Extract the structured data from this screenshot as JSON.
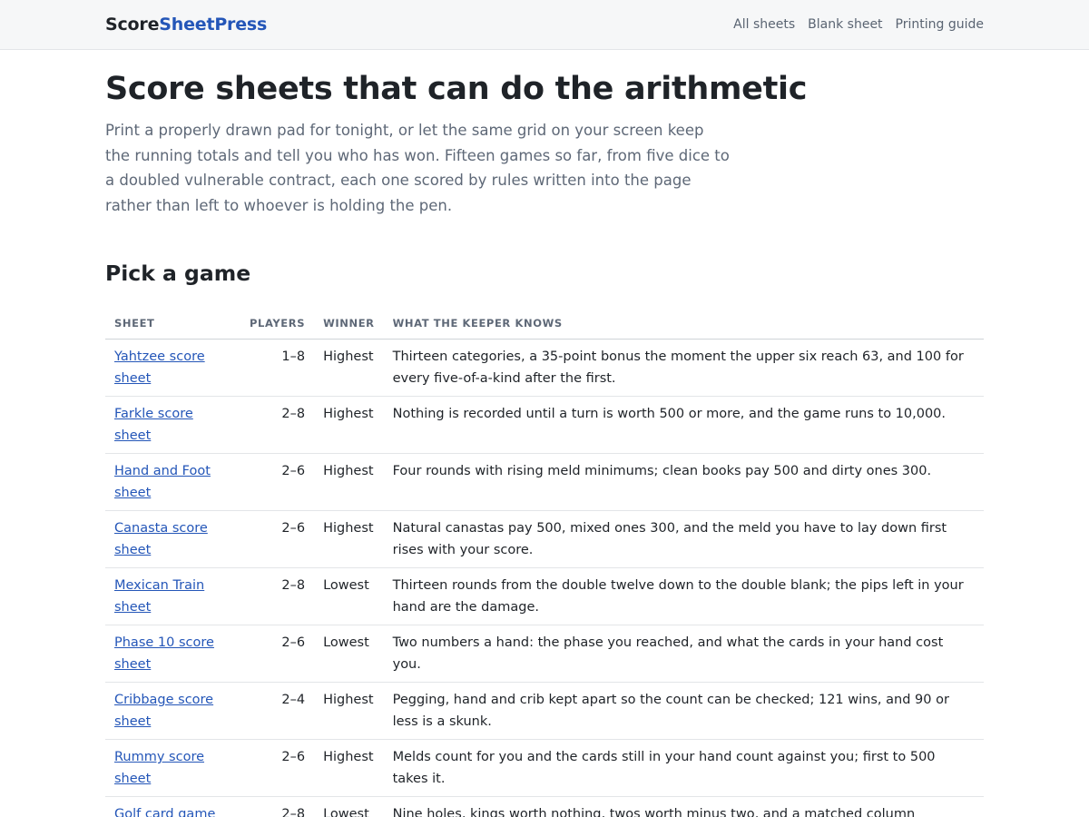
{
  "brand": {
    "part1": "Score",
    "part2": "SheetPress"
  },
  "nav": [
    "All sheets",
    "Blank sheet",
    "Printing guide"
  ],
  "hero": {
    "title": "Score sheets that can do the arithmetic",
    "intro": "Print a properly drawn pad for tonight, or let the same grid on your screen keep the running totals and tell you who has won. Fifteen games so far, from five dice to a doubled vulnerable contract, each one scored by rules written into the page rather than left to whoever is holding the pen."
  },
  "section_title": "Pick a game",
  "table": {
    "headers": [
      "Sheet",
      "Players",
      "Winner",
      "What the keeper knows"
    ],
    "rows": [
      {
        "sheet": "Yahtzee score sheet",
        "players": "1–8",
        "winner": "Highest",
        "notes": "Thirteen categories, a 35-point bonus the moment the upper six reach 63, and 100 for every five-of-a-kind after the first."
      },
      {
        "sheet": "Farkle score sheet",
        "players": "2–8",
        "winner": "Highest",
        "notes": "Nothing is recorded until a turn is worth 500 or more, and the game runs to 10,000."
      },
      {
        "sheet": "Hand and Foot sheet",
        "players": "2–6",
        "winner": "Highest",
        "notes": "Four rounds with rising meld minimums; clean books pay 500 and dirty ones 300."
      },
      {
        "sheet": "Canasta score sheet",
        "players": "2–6",
        "winner": "Highest",
        "notes": "Natural canastas pay 500, mixed ones 300, and the meld you have to lay down first rises with your score."
      },
      {
        "sheet": "Mexican Train sheet",
        "players": "2–8",
        "winner": "Lowest",
        "notes": "Thirteen rounds from the double twelve down to the double blank; the pips left in your hand are the damage."
      },
      {
        "sheet": "Phase 10 score sheet",
        "players": "2–6",
        "winner": "Lowest",
        "notes": "Two numbers a hand: the phase you reached, and what the cards in your hand cost you."
      },
      {
        "sheet": "Cribbage score sheet",
        "players": "2–4",
        "winner": "Highest",
        "notes": "Pegging, hand and crib kept apart so the count can be checked; 121 wins, and 90 or less is a skunk."
      },
      {
        "sheet": "Rummy score sheet",
        "players": "2–6",
        "winner": "Highest",
        "notes": "Melds count for you and the cards still in your hand count against you; first to 500 takes it."
      },
      {
        "sheet": "Golf card game sheet",
        "players": "2–8",
        "winner": "Lowest",
        "notes": "Nine holes, kings worth nothing, twos worth minus two, and a matched column cancelling to zero."
      }
    ]
  }
}
